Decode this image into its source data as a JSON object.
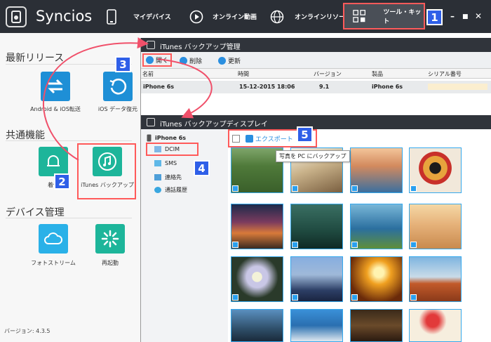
{
  "app": {
    "title": "Syncios",
    "version": "バージョン: 4.3.5"
  },
  "nav": {
    "my_device": "マイデバイス",
    "online_video": "オンライン動画",
    "online_resource": "オンラインリソース",
    "toolkit": "ツール・キット"
  },
  "sidebar": {
    "sections": [
      "最新リリース",
      "共通機能",
      "デバイス管理"
    ],
    "tiles": [
      {
        "label": "Android & iOS転送",
        "color": "#1e8fd6"
      },
      {
        "label": "iOS データ復元",
        "color": "#1e8fd6"
      },
      {
        "label": "着信",
        "color": "#1db59a"
      },
      {
        "label": "iTunes バックアップ",
        "color": "#1db59a"
      },
      {
        "label": "フォトストリーム",
        "color": "#2ab1e8"
      },
      {
        "label": "再起動",
        "color": "#1db59a"
      }
    ]
  },
  "backup_window": {
    "title": "iTunes バックアップ管理",
    "toolbar": {
      "open": "開く",
      "delete": "削除",
      "refresh": "更新"
    },
    "columns": [
      "名前",
      "時間",
      "バージョン",
      "製品",
      "シリアル番号"
    ],
    "rows": [
      {
        "name": "iPhone 6s",
        "time": "15-12-2015 18:06",
        "version": "9.1",
        "product": "iPhone 6s"
      }
    ]
  },
  "display_window": {
    "title": "iTunes バックアップディスプレイ",
    "device": "iPhone 6s",
    "categories": [
      "DCIM",
      "SMS",
      "連絡先",
      "通話履歴"
    ],
    "export_label": "エクスポート",
    "tooltip": "写真を PC にバックアップ"
  },
  "badges": [
    "1",
    "2",
    "3",
    "4",
    "5"
  ],
  "colors": {
    "accent": "#2f5fe8",
    "highlight": "#ff5a5a",
    "thumb_border": "#35a9ee"
  }
}
